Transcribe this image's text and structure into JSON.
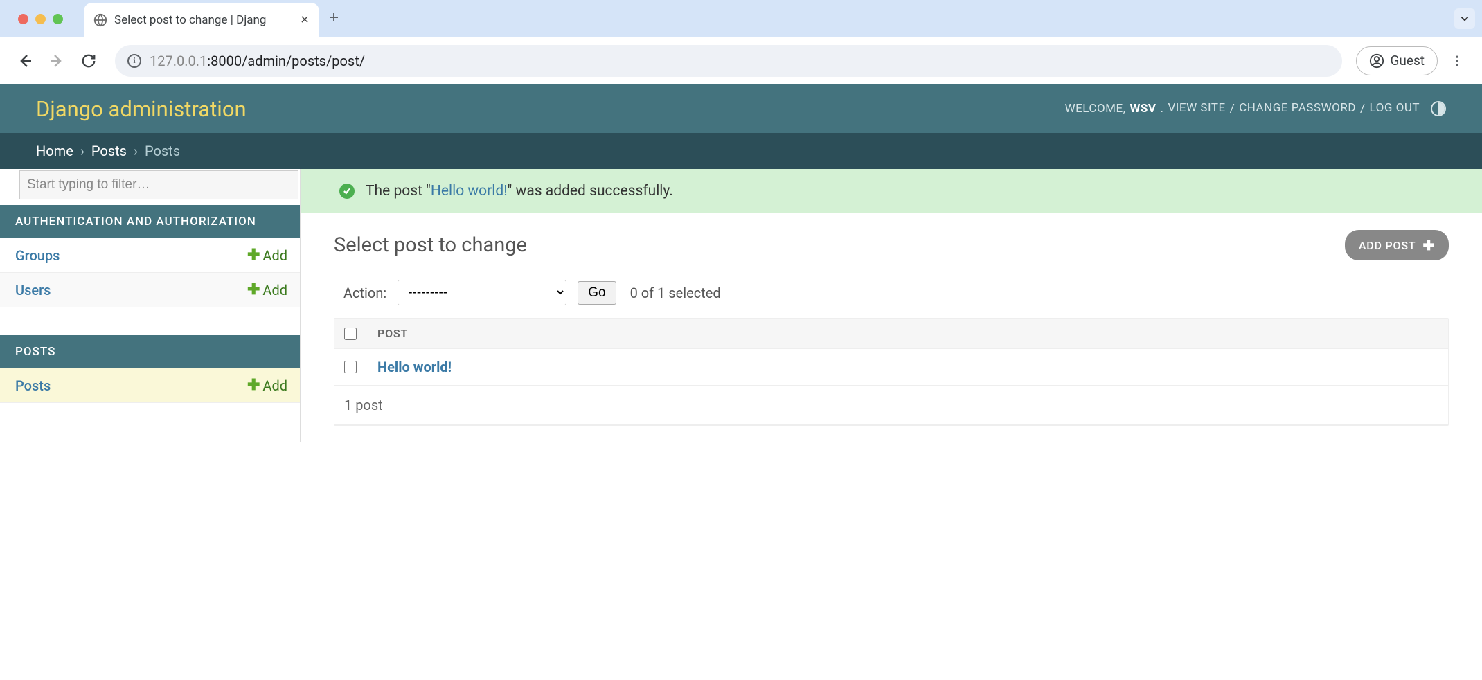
{
  "browser": {
    "tab_title": "Select post to change | Djang",
    "url_host": "127.0.0.1",
    "url_path": ":8000/admin/posts/post/",
    "guest_label": "Guest"
  },
  "header": {
    "title": "Django administration",
    "welcome_prefix": "WELCOME,",
    "username": "WSV",
    "view_site": "VIEW SITE",
    "change_password": "CHANGE PASSWORD",
    "logout": "LOG OUT"
  },
  "breadcrumbs": {
    "home": "Home",
    "app": "Posts",
    "current": "Posts"
  },
  "sidebar": {
    "filter_placeholder": "Start typing to filter…",
    "apps": [
      {
        "caption": "AUTHENTICATION AND AUTHORIZATION",
        "models": [
          {
            "name": "Groups",
            "add": "Add"
          },
          {
            "name": "Users",
            "add": "Add"
          }
        ]
      },
      {
        "caption": "POSTS",
        "models": [
          {
            "name": "Posts",
            "add": "Add"
          }
        ]
      }
    ]
  },
  "message": {
    "prefix": "The post \"",
    "link": "Hello world!",
    "suffix": "\" was added successfully."
  },
  "content": {
    "title": "Select post to change",
    "add_button": "ADD POST",
    "action_label": "Action:",
    "action_placeholder": "---------",
    "go_label": "Go",
    "selection_counter": "0 of 1 selected",
    "column_header": "POST",
    "rows": [
      {
        "title": "Hello world!"
      }
    ],
    "paginator": "1 post"
  }
}
